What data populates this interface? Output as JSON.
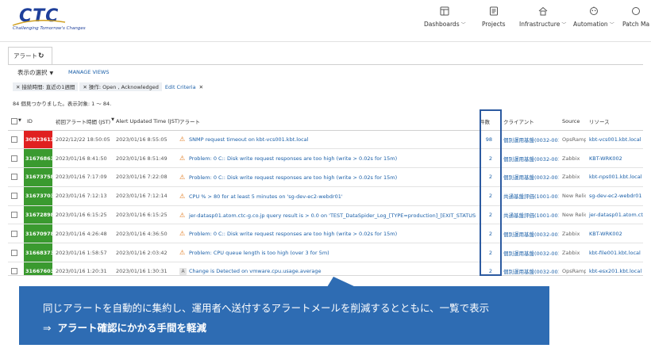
{
  "brand": {
    "name": "CTC",
    "tagline": "Challenging Tomorrow's Changes",
    "color": "#1e3f9a"
  },
  "nav": [
    {
      "label": "Dashboards",
      "icon": "dashboard-icon",
      "has_dropdown": true
    },
    {
      "label": "Projects",
      "icon": "projects-icon",
      "has_dropdown": false
    },
    {
      "label": "Infrastructure",
      "icon": "infrastructure-icon",
      "has_dropdown": true
    },
    {
      "label": "Automation",
      "icon": "automation-icon",
      "has_dropdown": true
    },
    {
      "label": "Patch Ma",
      "icon": "",
      "has_dropdown": false
    }
  ],
  "tab": {
    "label": "アラート",
    "icon": "refresh-icon"
  },
  "toolbar": {
    "view_select": "表示の選択",
    "manage_views": "MANAGE VIEWS",
    "filters": [
      "接続時間: 直近の1週間",
      "操作: Open , Acknowledged"
    ],
    "edit_criteria": "Edit Criteria",
    "result_text": "84 個見つかりました。表示対象: 1 ～ 84."
  },
  "table": {
    "columns": [
      "ID",
      "初回アラート時間 (JST)",
      "Alert Updated Time (JST)",
      "アラート",
      "件数",
      "クライアント",
      "Source",
      "リソース"
    ],
    "rows": [
      {
        "id": "30823613",
        "id_color": "#e02020",
        "first": "2022/12/22 18:50:05",
        "updated": "2023/01/16 8:55:05",
        "icon": "warning-icon",
        "alert": "SNMP request timeout on kbt-vcs001.kbt.local",
        "count": "98",
        "client": "個別運用基盤(0032-001)",
        "source": "OpsRamp",
        "resource": "kbt-vcs001.kbt.local"
      },
      {
        "id": "31676863",
        "id_color": "#3a9a2f",
        "first": "2023/01/16 8:41:50",
        "updated": "2023/01/16 8:51:49",
        "icon": "warning-icon",
        "alert": "Problem: 0 C:: Disk write request responses are too high (write > 0.02s for 15m)",
        "count": "2",
        "client": "個別運用基盤(0032-001)",
        "source": "Zabbix",
        "resource": "KBT-WRK002"
      },
      {
        "id": "31673758",
        "id_color": "#3a9a2f",
        "first": "2023/01/16 7:17:09",
        "updated": "2023/01/16 7:22:08",
        "icon": "warning-icon",
        "alert": "Problem: 0 C:: Disk write request responses are too high (write > 0.02s for 15m)",
        "count": "2",
        "client": "個別運用基盤(0032-001)",
        "source": "Zabbix",
        "resource": "kbt-nps001.kbt.local"
      },
      {
        "id": "31673703",
        "id_color": "#3a9a2f",
        "first": "2023/01/16 7:12:13",
        "updated": "2023/01/16 7:12:14",
        "icon": "warning-icon",
        "alert": "CPU % > 80 for at least 5 minutes on 'sg-dev-ec2-webdr01'",
        "count": "2",
        "client": "共通基盤評価(1001-001)",
        "source": "New Relic",
        "resource": "sg-dev-ec2-webdr01"
      },
      {
        "id": "31672898",
        "id_color": "#3a9a2f",
        "first": "2023/01/16 6:15:25",
        "updated": "2023/01/16 6:15:25",
        "icon": "warning-icon",
        "alert": "jer-datasp01.atom.ctc-g.co.jp query result is > 0.0 on 'TEST_DataSpider_Log_[TYPE=production]_[EXIT_STATUS=0]'",
        "count": "2",
        "client": "共通基盤評価(1001-001)",
        "source": "New Relic",
        "resource": "jer-datasp01.atom.ctc-g..."
      },
      {
        "id": "31670978",
        "id_color": "#3a9a2f",
        "first": "2023/01/16 4:26:48",
        "updated": "2023/01/16 4:36:50",
        "icon": "warning-icon",
        "alert": "Problem: 0 C:: Disk write request responses are too high (write > 0.02s for 15m)",
        "count": "2",
        "client": "個別運用基盤(0032-001)",
        "source": "Zabbix",
        "resource": "KBT-WRK002"
      },
      {
        "id": "31668373",
        "id_color": "#3a9a2f",
        "first": "2023/01/16 1:58:57",
        "updated": "2023/01/16 2:03:42",
        "icon": "warning-icon",
        "alert": "Problem: CPU queue length is too high (over 3 for 5m)",
        "count": "2",
        "client": "個別運用基盤(0032-001)",
        "source": "Zabbix",
        "resource": "kbt-file001.kbt.local"
      },
      {
        "id": "31667603",
        "id_color": "#3a9a2f",
        "first": "2023/01/16 1:20:31",
        "updated": "2023/01/16 1:30:31",
        "icon": "a-badge-icon",
        "alert": "Change is Detected on vmware.cpu.usage.average",
        "count": "2",
        "client": "個別運用基盤(0032-001)",
        "source": "OpsRamp",
        "resource": "kbt-esx201.kbt.local"
      }
    ]
  },
  "callout": {
    "line1": "同じアラートを自動的に集約し、運用者へ送付するアラートメールを削減するとともに、一覧で表示",
    "arrow": "⇒",
    "line2": "アラート確認にかかる手間を軽減",
    "color": "#2e6cb3"
  }
}
